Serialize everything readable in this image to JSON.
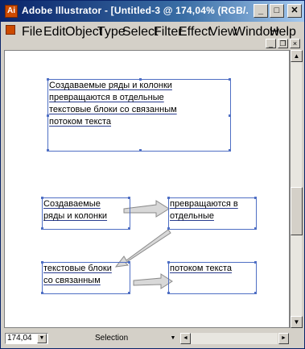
{
  "window": {
    "title": "Adobe Illustrator - [Untitled-3 @ 174,04% (RGB/...",
    "min_symbol": "_",
    "max_symbol": "□",
    "close_symbol": "✕"
  },
  "menu": {
    "items": [
      "File",
      "Edit",
      "Object",
      "Type",
      "Select",
      "Filter",
      "Effect",
      "View",
      "Window",
      "Help"
    ]
  },
  "doc_controls": {
    "minimize": "_",
    "restore": "❐",
    "close": "×"
  },
  "canvas": {
    "main_box_lines": [
      "Создаваемые ряды и колонки",
      "превращаются в отдельные",
      "текстовые блоки со связанным",
      "потоком текста"
    ],
    "box1_lines": [
      "Создаваемые",
      "ряды и колонки"
    ],
    "box2_lines": [
      "превращаются в",
      "отдельные"
    ],
    "box3_lines": [
      "текстовые блоки",
      "со связанным"
    ],
    "box4_lines": [
      "потоком текста"
    ],
    "accent_color": "#4f6fc4",
    "arrow_color": "#8a8a8a"
  },
  "status": {
    "zoom": "174,04",
    "tool": "Selection"
  },
  "icons": {
    "app": "illustrator-logo-icon",
    "scroll_up": "▲",
    "scroll_down": "▼",
    "scroll_left": "◄",
    "scroll_right": "►",
    "dropdown": "▼"
  }
}
